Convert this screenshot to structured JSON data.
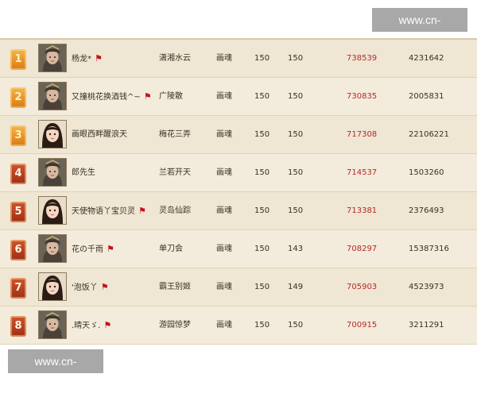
{
  "watermarks": {
    "top": "www.cn-cljt.com",
    "bottom": "www.cn-cljt.com"
  },
  "ranking": {
    "rows": [
      {
        "rank": "1",
        "name": "杨龙*",
        "has_flag": true,
        "guild": "潇湘水云",
        "job": "画魂",
        "level": "150",
        "sub_level": "150",
        "score": "738539",
        "power": "4231642",
        "avatar": "male",
        "badge": "gold"
      },
      {
        "rank": "2",
        "name": "又撞桃花换酒钱^~",
        "has_flag": true,
        "guild": "广陵散",
        "job": "画魂",
        "level": "150",
        "sub_level": "150",
        "score": "730835",
        "power": "2005831",
        "avatar": "male",
        "badge": "gold"
      },
      {
        "rank": "3",
        "name": "画眼西畔醒浪天",
        "has_flag": false,
        "guild": "梅花三弄",
        "job": "画魂",
        "level": "150",
        "sub_level": "150",
        "score": "717308",
        "power": "22106221",
        "avatar": "female",
        "badge": "gold"
      },
      {
        "rank": "4",
        "name": "郎先生",
        "has_flag": false,
        "guild": "兰若开天",
        "job": "画魂",
        "level": "150",
        "sub_level": "150",
        "score": "714537",
        "power": "1503260",
        "avatar": "male",
        "badge": "red"
      },
      {
        "rank": "5",
        "name": "天使物语丫宝贝灵",
        "has_flag": true,
        "guild": "灵岛仙踪",
        "job": "画魂",
        "level": "150",
        "sub_level": "150",
        "score": "713381",
        "power": "2376493",
        "avatar": "female",
        "badge": "red"
      },
      {
        "rank": "6",
        "name": "花の千雨",
        "has_flag": true,
        "guild": "单刀会",
        "job": "画魂",
        "level": "150",
        "sub_level": "143",
        "score": "708297",
        "power": "15387316",
        "avatar": "male",
        "badge": "red"
      },
      {
        "rank": "7",
        "name": "'泡饭丫",
        "has_flag": true,
        "guild": "霸王别姬",
        "job": "画魂",
        "level": "150",
        "sub_level": "149",
        "score": "705903",
        "power": "4523973",
        "avatar": "female",
        "badge": "red"
      },
      {
        "rank": "8",
        "name": ".晴天ゞ.",
        "has_flag": true,
        "guild": "游园惊梦",
        "job": "画魂",
        "level": "150",
        "sub_level": "150",
        "score": "700915",
        "power": "3211291",
        "avatar": "male",
        "badge": "red"
      }
    ]
  },
  "icons": {
    "flag": "red-flag-icon",
    "avatar_male": "warrior-portrait-icon",
    "avatar_female": "lady-portrait-icon"
  },
  "colors": {
    "score_text": "#b32a2a",
    "badge_gold": "#e89a2a",
    "badge_red": "#b8401e",
    "board_bg": "#efe6d3"
  }
}
